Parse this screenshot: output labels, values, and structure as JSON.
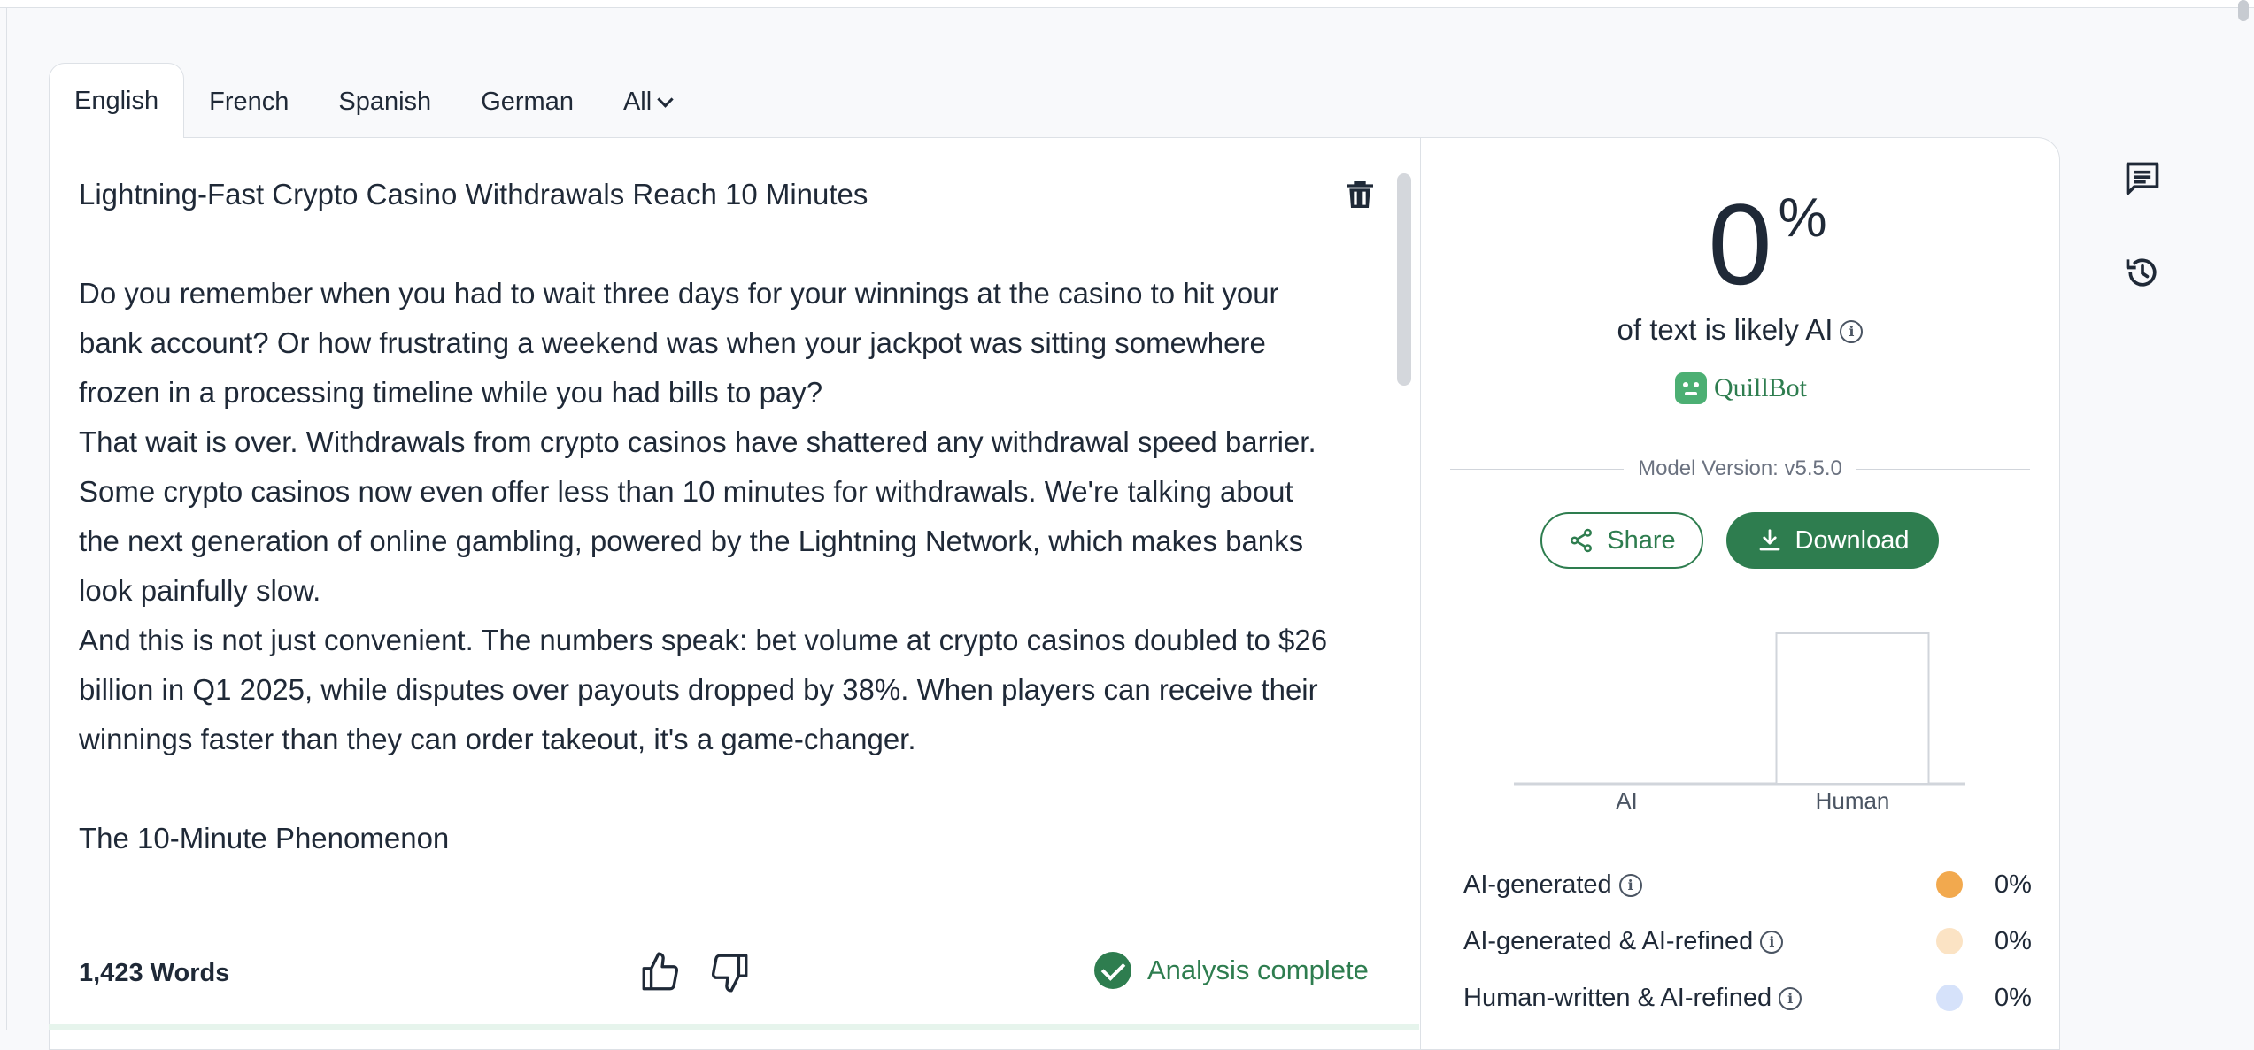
{
  "tabs": [
    {
      "label": "English",
      "active": true
    },
    {
      "label": "French"
    },
    {
      "label": "Spanish"
    },
    {
      "label": "German"
    },
    {
      "label": "All"
    }
  ],
  "editor": {
    "paragraphs": [
      "Lightning-Fast Crypto Casino Withdrawals Reach 10 Minutes",
      "",
      "Do you remember when you had to wait three days for your winnings at the casino to hit your bank account? Or how frustrating a weekend was when your jackpot was sitting somewhere frozen in a processing timeline while you had bills to pay?",
      "That wait is over. Withdrawals from crypto casinos have shattered any withdrawal speed barrier. Some crypto casinos now even offer less than 10 minutes for withdrawals. We're talking about the next generation of online gambling, powered by the Lightning Network, which makes banks look painfully slow.",
      "And this is not just convenient. The numbers speak: bet volume at crypto casinos doubled to $26 billion in Q1 2025, while disputes over payouts dropped by 38%. When players can receive their winnings faster than they can order takeout, it's a game-changer.",
      "",
      "The 10-Minute Phenomenon"
    ],
    "word_count": "1,423 Words",
    "status": "Analysis complete"
  },
  "results": {
    "score": "0",
    "score_unit": "%",
    "likely_label": "of text is likely AI",
    "brand": "QuillBot",
    "model_version": "Model Version: v5.5.0",
    "share_label": "Share",
    "download_label": "Download",
    "legend": [
      {
        "label": "AI-generated",
        "value": "0%",
        "color": "#f2a94e"
      },
      {
        "label": "AI-generated & AI-refined",
        "value": "0%",
        "color": "#fbe3c4"
      },
      {
        "label": "Human-written & AI-refined",
        "value": "0%",
        "color": "#d6e2fa"
      }
    ]
  },
  "chart_data": {
    "type": "bar",
    "categories": [
      "AI",
      "Human"
    ],
    "values": [
      0,
      100
    ],
    "ylim": [
      0,
      100
    ]
  },
  "colors": {
    "accent": "#2e7d4f",
    "border": "#dde1e6"
  }
}
